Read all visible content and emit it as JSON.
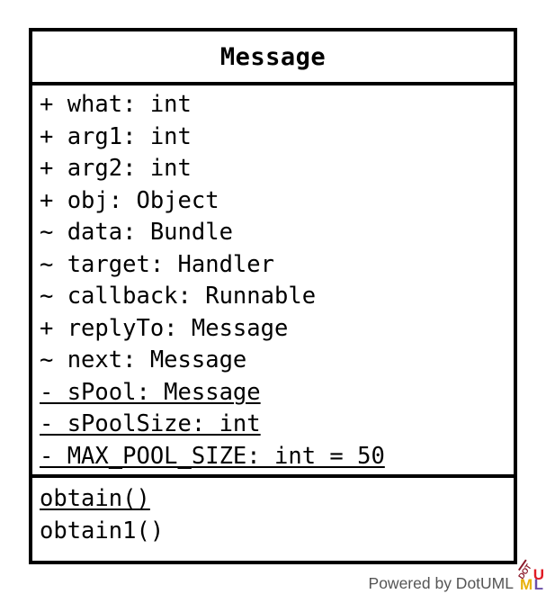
{
  "diagram": {
    "type": "uml-class-diagram",
    "class_name": "Message",
    "attributes": [
      {
        "text": "+ what: int",
        "visibility": "public",
        "static": false
      },
      {
        "text": "+ arg1: int",
        "visibility": "public",
        "static": false
      },
      {
        "text": "+ arg2: int",
        "visibility": "public",
        "static": false
      },
      {
        "text": "+ obj: Object",
        "visibility": "public",
        "static": false
      },
      {
        "text": "~ data: Bundle",
        "visibility": "package",
        "static": false
      },
      {
        "text": "~ target: Handler",
        "visibility": "package",
        "static": false
      },
      {
        "text": "~ callback: Runnable",
        "visibility": "package",
        "static": false
      },
      {
        "text": "+ replyTo: Message",
        "visibility": "public",
        "static": false
      },
      {
        "text": "~ next: Message",
        "visibility": "package",
        "static": false
      },
      {
        "text": "- sPool: Message",
        "visibility": "private",
        "static": true
      },
      {
        "text": "- sPoolSize: int",
        "visibility": "private",
        "static": true
      },
      {
        "text": "- MAX_POOL_SIZE: int = 50",
        "visibility": "private",
        "static": true
      }
    ],
    "operations": [
      {
        "text": "obtain()",
        "static": true
      },
      {
        "text": "obtain1()",
        "static": false
      }
    ]
  },
  "watermark": {
    "text": "Powered by DotUML",
    "logo": {
      "dot": "DOT",
      "u": "U",
      "m": "M",
      "l": "L",
      "colors": {
        "dot": "#8b1a2b",
        "u": "#e01b24",
        "m": "#e8b10a",
        "l": "#6b4fa8",
        "text": "#555555"
      }
    }
  },
  "style": {
    "border_color": "#000000",
    "background_color": "#ffffff",
    "text_color": "#000000"
  }
}
